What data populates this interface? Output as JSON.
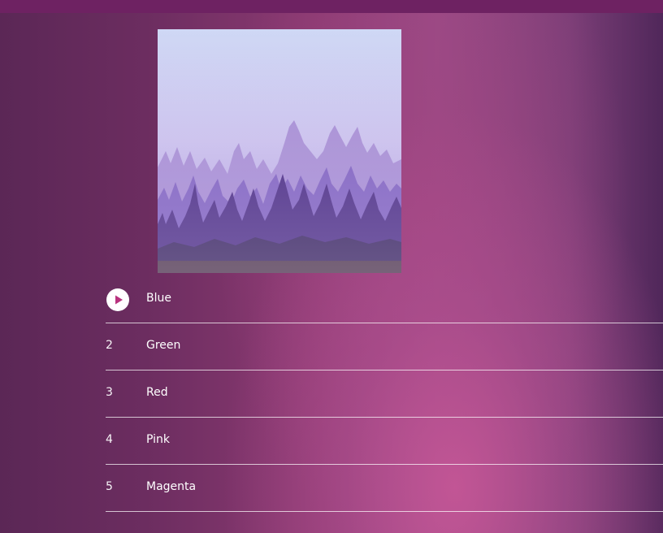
{
  "colors": {
    "accent": "#b8327e",
    "play_button_bg": "#ffffff",
    "divider": "#e9d5e6",
    "text": "#ffffff"
  },
  "album": {
    "cover_icon": "album-cover-misty-purple-forest"
  },
  "tracks": [
    {
      "number": "1",
      "title": "Blue",
      "playing": true,
      "icon": "play-icon"
    },
    {
      "number": "2",
      "title": "Green"
    },
    {
      "number": "3",
      "title": "Red"
    },
    {
      "number": "4",
      "title": "Pink"
    },
    {
      "number": "5",
      "title": "Magenta"
    }
  ]
}
